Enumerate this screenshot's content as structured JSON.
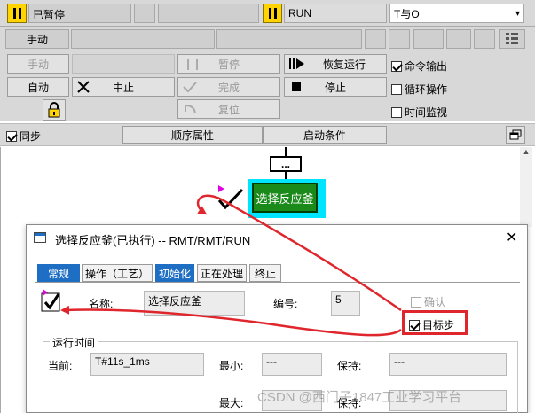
{
  "status_bar": {
    "state_text": "已暂停",
    "mode_text": "RUN",
    "dropdown_value": "T与O"
  },
  "toolbar2": {
    "mode_label": "手动"
  },
  "controls": {
    "manual": "手动",
    "auto": "自动",
    "pause": "暂停",
    "resume": "恢复运行",
    "abort": "中止",
    "complete": "完成",
    "stop": "停止",
    "reset": "复位",
    "cmd_output": "命令输出",
    "cyclic": "循环操作",
    "time_monitor": "时间监视"
  },
  "seq_bar": {
    "sync": "同步",
    "seq_props": "顺序属性",
    "start_cond": "启动条件"
  },
  "canvas": {
    "transition_label": "...",
    "step_label": "选择反应釜"
  },
  "dialog": {
    "title": "选择反应釜(已执行) -- RMT/RMT/RUN",
    "tabs": [
      "常规",
      "操作（工艺）",
      "初始化",
      "正在处理",
      "终止"
    ],
    "name_label": "名称:",
    "name_value": "选择反应釜",
    "number_label": "编号:",
    "number_value": "5",
    "confirm_label": "确认",
    "target_step_label": "目标步",
    "runtime_group": "运行时间",
    "current_label": "当前:",
    "current_value": "T#11s_1ms",
    "min_label": "最小:",
    "min_value": "---",
    "hold_label": "保持:",
    "hold_value": "---",
    "max_label": "最大:",
    "hold2_label": "保持:"
  },
  "watermark": "CSDN @西门子1847工业学习平台",
  "colors": {
    "step_fill": "#1a8a1a",
    "step_highlight": "#00e5ff",
    "pause_yellow": "#ffd400",
    "annotation_red": "#e0262d",
    "tab_blue": "#1e6fc4"
  }
}
